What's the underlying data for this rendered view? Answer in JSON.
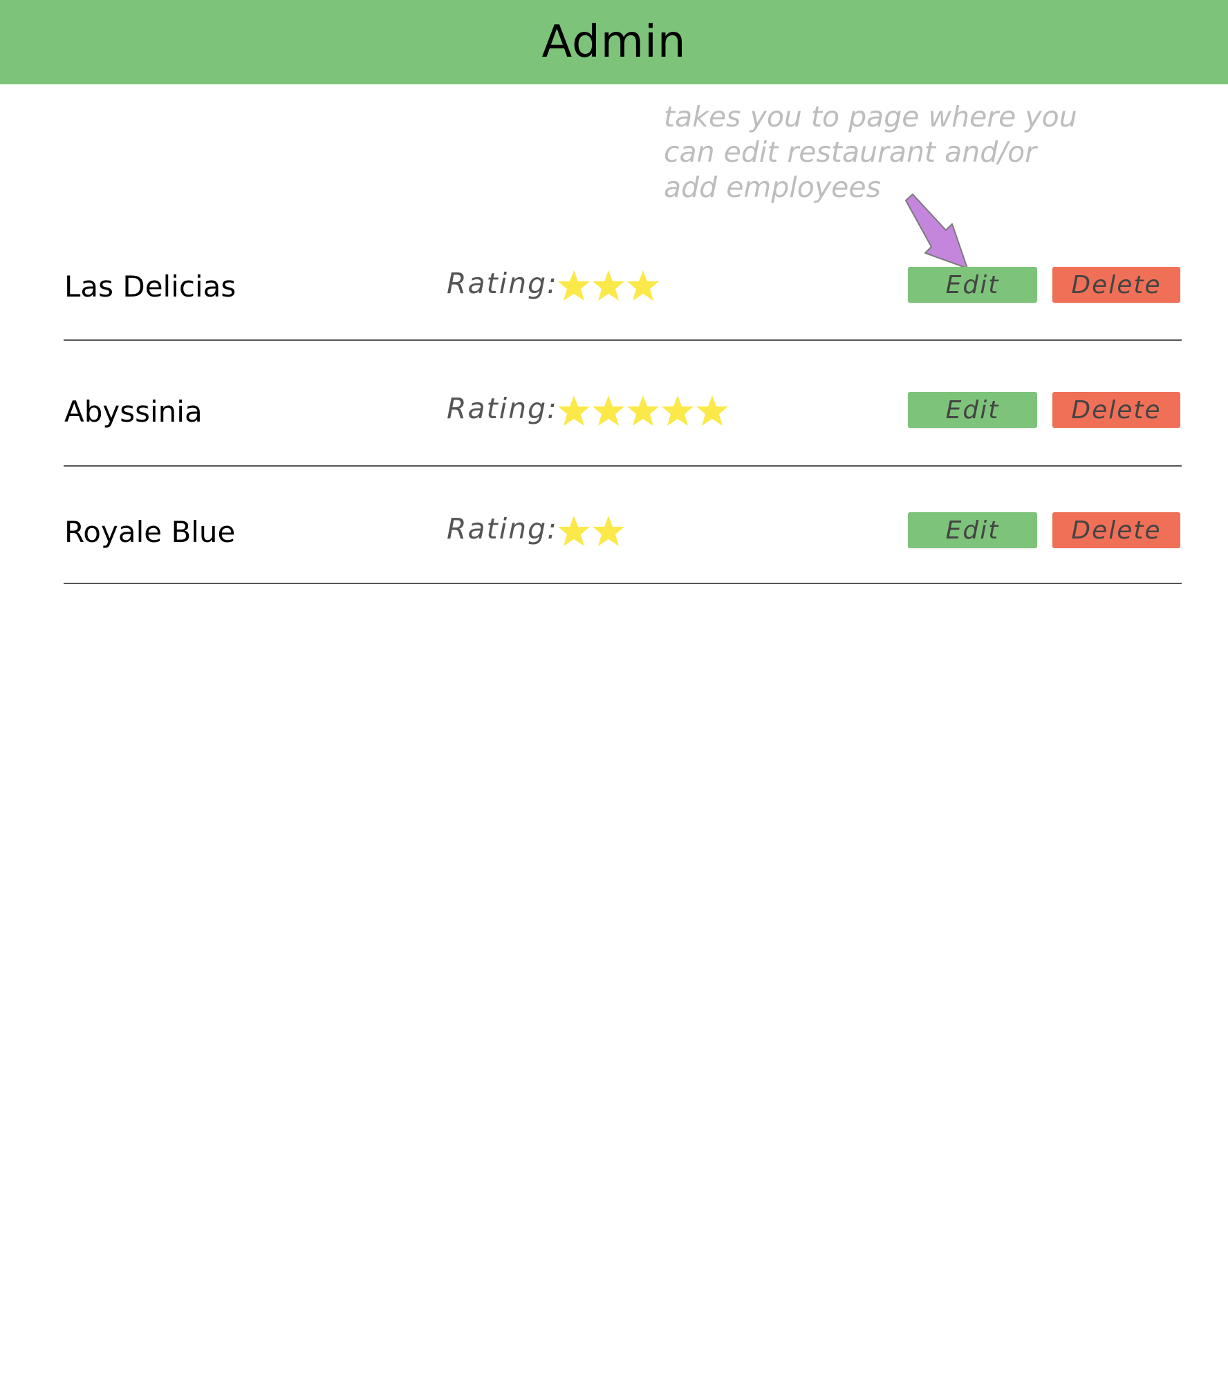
{
  "colors": {
    "header_bg": "#7dc47a",
    "edit_bg": "#7dc47a",
    "delete_bg": "#f07057",
    "star": "#fbe94a",
    "arrow": "#c386dc",
    "annotation_text": "#bdbdbd"
  },
  "header": {
    "title": "Admin"
  },
  "annotation": {
    "text": "takes you to page where you\ncan edit restaurant  and/or\nadd employees",
    "icon": "arrow-down-right-icon"
  },
  "restaurants": [
    {
      "name": "Las Delicias",
      "rating_label": "Rating:",
      "rating": 3,
      "edit_label": "Edit",
      "delete_label": "Delete"
    },
    {
      "name": "Abyssinia",
      "rating_label": "Rating:",
      "rating": 5,
      "edit_label": "Edit",
      "delete_label": "Delete"
    },
    {
      "name": "Royale Blue",
      "rating_label": "Rating:",
      "rating": 2,
      "edit_label": "Edit",
      "delete_label": "Delete"
    }
  ]
}
